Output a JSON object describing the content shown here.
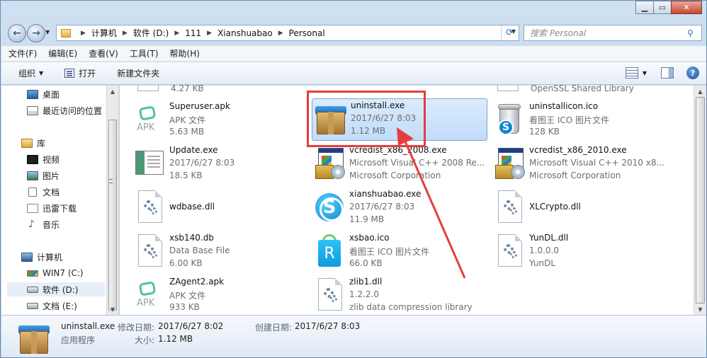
{
  "address": {
    "crumbs": [
      "计算机",
      "软件 (D:)",
      "111",
      "Xianshuabao",
      "Personal"
    ]
  },
  "search": {
    "placeholder": "搜索 Personal"
  },
  "menu": [
    "文件(F)",
    "编辑(E)",
    "查看(V)",
    "工具(T)",
    "帮助(H)"
  ],
  "toolbar": {
    "organize": "组织",
    "open": "打开",
    "new_folder": "新建文件夹"
  },
  "nav": {
    "items": [
      {
        "label": "桌面",
        "icon": "desktop-icon"
      },
      {
        "label": "最近访问的位置",
        "icon": "recent-places-icon"
      },
      {
        "label": "库",
        "icon": "library-icon"
      },
      {
        "label": "视频",
        "icon": "video-icon"
      },
      {
        "label": "图片",
        "icon": "pictures-icon"
      },
      {
        "label": "文档",
        "icon": "documents-icon"
      },
      {
        "label": "迅雷下载",
        "icon": "xunlei-download-icon"
      },
      {
        "label": "音乐",
        "icon": "music-icon"
      },
      {
        "label": "计算机",
        "icon": "computer-icon"
      },
      {
        "label": "WIN7 (C:)",
        "icon": "drive-c-icon"
      },
      {
        "label": "软件 (D:)",
        "icon": "drive-d-icon",
        "selected": true
      },
      {
        "label": "文档 (E:)",
        "icon": "drive-e-icon"
      }
    ]
  },
  "partial_top": {
    "left_size": "4.27 KB",
    "right_desc": "OpenSSL Shared Library"
  },
  "files": [
    {
      "name": "Superuser.apk",
      "l2": "APK 文件",
      "l3": "5.63 MB",
      "icon": "apk-icon"
    },
    {
      "name": "uninstall.exe",
      "l2": "2017/6/27 8:03",
      "l3": "1.12 MB",
      "icon": "installer-box-icon",
      "selected": true
    },
    {
      "name": "uninstallicon.ico",
      "l2": "看图王 ICO 图片文件",
      "l3": "128 KB",
      "icon": "trash-can-icon"
    },
    {
      "name": "Update.exe",
      "l2": "2017/6/27 8:03",
      "l3": "18.5 KB",
      "icon": "window-app-icon"
    },
    {
      "name": "vcredist_x86_2008.exe",
      "l2": "Microsoft Visual C++ 2008 Re...",
      "l3": "Microsoft Corporation",
      "icon": "vcredist-icon"
    },
    {
      "name": "vcredist_x86_2010.exe",
      "l2": "Microsoft Visual C++ 2010  x8...",
      "l3": "Microsoft Corporation",
      "icon": "vcredist-icon"
    },
    {
      "name": "wdbase.dll",
      "l2": "",
      "l3": "",
      "icon": "dll-gear-icon"
    },
    {
      "name": "xianshuabao.exe",
      "l2": "2017/6/27 8:03",
      "l3": "11.9 MB",
      "icon": "s-logo-icon"
    },
    {
      "name": "XLCrypto.dll",
      "l2": "",
      "l3": "",
      "icon": "dll-gear-icon"
    },
    {
      "name": "xsb140.db",
      "l2": "Data Base File",
      "l3": "6.00 KB",
      "icon": "dll-gear-icon"
    },
    {
      "name": "xsbao.ico",
      "l2": "看图王 ICO 图片文件",
      "l3": "66.0 KB",
      "icon": "r-bag-icon"
    },
    {
      "name": "YunDL.dll",
      "l2": "1.0.0.0",
      "l3": "YunDL",
      "icon": "dll-gear-icon"
    },
    {
      "name": "ZAgent2.apk",
      "l2": "APK 文件",
      "l3": "933 KB",
      "icon": "apk-icon"
    },
    {
      "name": "zlib1.dll",
      "l2": "1.2.2.0",
      "l3": "zlib data compression library",
      "icon": "dll-gear-icon"
    }
  ],
  "status": {
    "name": "uninstall.exe",
    "type": "应用程序",
    "modified_label": "修改日期:",
    "modified": "2017/6/27 8:02",
    "created_label": "创建日期:",
    "created": "2017/6/27 8:03",
    "size_label": "大小:",
    "size": "1.12 MB"
  },
  "colors": {
    "annotation": "#e53d3d",
    "selection": "#c1dcf9"
  }
}
